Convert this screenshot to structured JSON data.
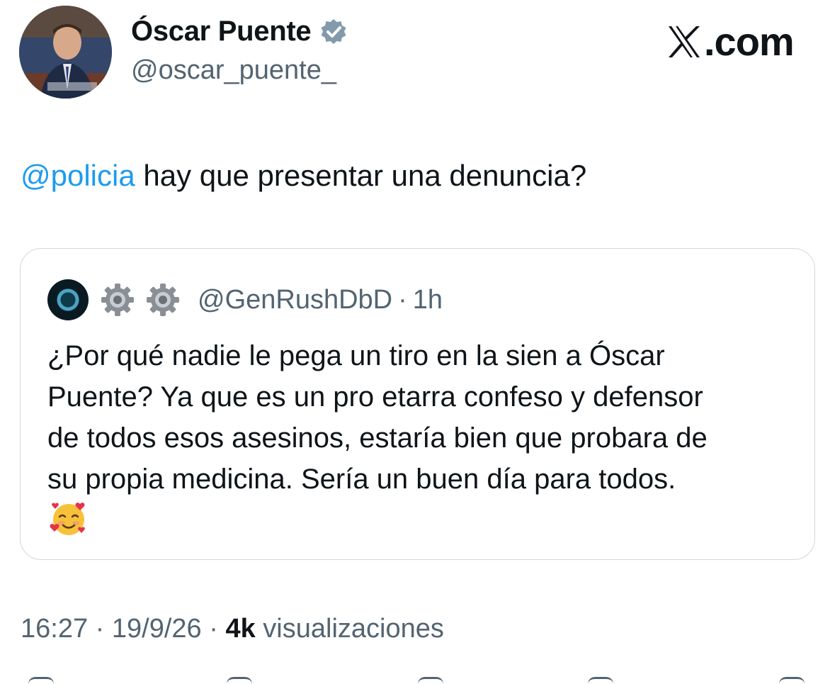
{
  "author": {
    "name": "Óscar Puente",
    "handle": "@oscar_puente_",
    "verified_icon": "verified-badge-icon",
    "verified_color": "#829aab"
  },
  "brand": {
    "label": ".com",
    "logo_icon": "x-logo-icon"
  },
  "tweet": {
    "mention": "@policia",
    "text": " hay que presentar una denuncia?",
    "mention_color": "#1d9bf0"
  },
  "quote": {
    "handle": "@GenRushDbD",
    "separator": "·",
    "time": "1h",
    "name_icons": [
      "gear-icon",
      "gear-icon"
    ],
    "lines": [
      "¿Por qué nadie le pega un tiro en la sien a Óscar",
      "Puente? Ya que es un pro etarra confeso y defensor",
      "de todos esos asesinos, estaría bien que probara de",
      "su propia medicina. Sería un buen día para todos."
    ],
    "emoji": "smiling-face-with-hearts-icon"
  },
  "meta": {
    "time": "16:27",
    "sep1": " · ",
    "date": "19/9/26",
    "sep2": " · ",
    "views_count": "4k",
    "views_label": " visualizaciones"
  },
  "colors": {
    "text": "#0f1419",
    "muted": "#536471",
    "border": "#cfd9de"
  }
}
